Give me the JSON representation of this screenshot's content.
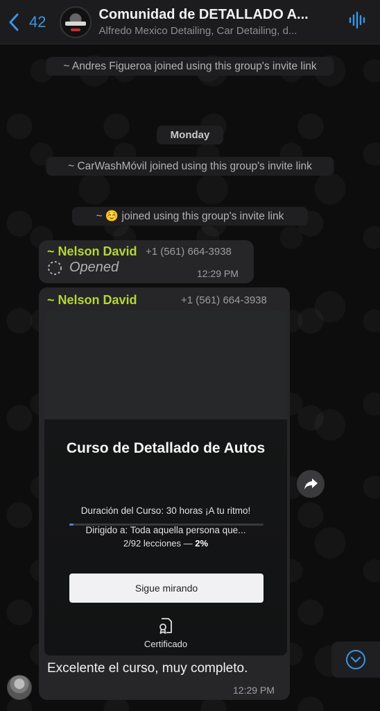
{
  "header": {
    "back_count": "42",
    "title": "Comunidad de DETALLADO A...",
    "subtitle": "Alfredo Mexico Detailing, Car Detailing, d..."
  },
  "system_messages": [
    {
      "text": "~ Andres Figueroa joined using this group's invite link"
    },
    {
      "text": "Monday"
    },
    {
      "text": "~ CarWashMóvil joined using this group's invite link"
    },
    {
      "text": "~ ☺️ joined using this group's invite link"
    }
  ],
  "messages": [
    {
      "sender": "~ Nelson David",
      "phone": "+1 (561) 664-3938",
      "body": "Opened",
      "time": "12:29 PM"
    },
    {
      "sender": "~ Nelson David",
      "phone": "+1 (561) 664-3938",
      "card": {
        "title": "Curso de Detallado de Autos",
        "duration": "Duración del Curso: 30 horas ¡A tu ritmo!",
        "audience": "Dirigido a: Toda aquella persona que...",
        "lessons_text": "2/92 lecciones — ",
        "percent_text": "2%",
        "progress": 0.02,
        "cta": "Sigue mirando",
        "certificate": "Certificado"
      },
      "body": "Excelente el curso,  muy completo.",
      "time": "12:29 PM"
    }
  ],
  "icons": {
    "back": "chevron-left-icon",
    "voice": "waveform-icon",
    "opened": "dashed-circle-icon",
    "forward": "forward-arrow-icon",
    "scroll": "chevron-down-circle-icon",
    "certificate": "certificate-icon"
  },
  "colors": {
    "accent": "#3b96e6",
    "sender": "#b5d53a",
    "bubble": "#262628"
  }
}
